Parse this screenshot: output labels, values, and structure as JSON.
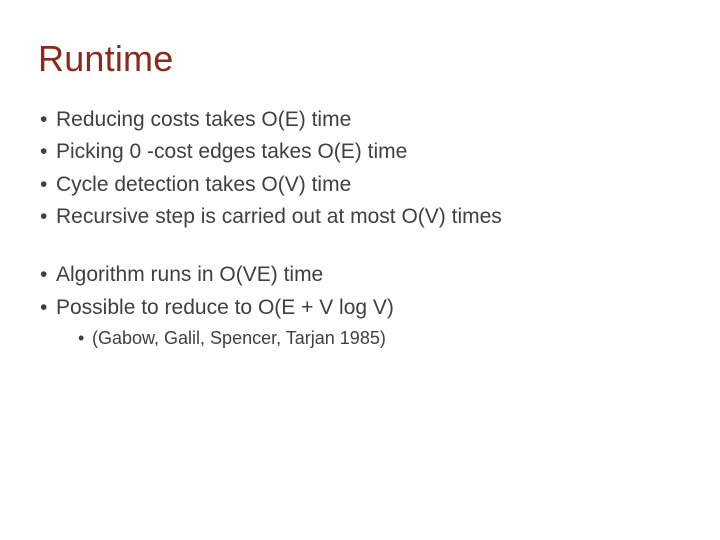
{
  "title": "Runtime",
  "group1": {
    "b1": "Reducing costs takes O(E) time",
    "b2": "Picking 0 -cost edges takes O(E) time",
    "b3": "Cycle detection takes O(V) time",
    "b4": "Recursive step is carried out at most O(V) times"
  },
  "group2": {
    "b1": "Algorithm runs in O(VE) time",
    "b2": "Possible to reduce to O(E + V log V)",
    "sub1": "(Gabow, Galil, Spencer, Tarjan 1985)"
  }
}
